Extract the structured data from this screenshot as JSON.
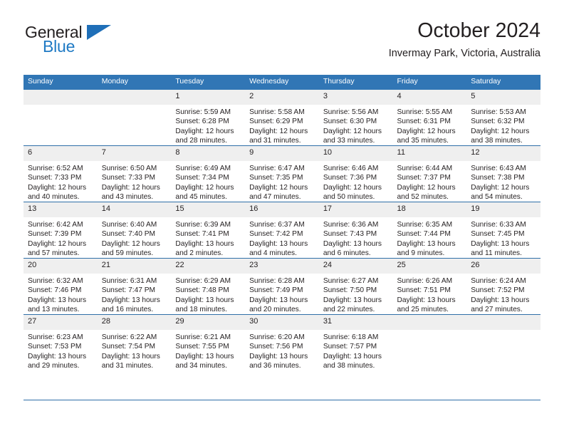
{
  "brand": {
    "name_top": "General",
    "name_bottom": "Blue",
    "icon": "triangle-logo-icon",
    "color_top": "#231f20",
    "color_bottom": "#1f7ac4",
    "triangle_color": "#1f6fb8"
  },
  "header": {
    "title": "October 2024",
    "subtitle": "Invermay Park, Victoria, Australia"
  },
  "theme": {
    "header_blue": "#3176b5",
    "rule_blue": "#2f6fa8",
    "daynum_band": "#efefef"
  },
  "weekdays": [
    "Sunday",
    "Monday",
    "Tuesday",
    "Wednesday",
    "Thursday",
    "Friday",
    "Saturday"
  ],
  "labels": {
    "sunrise": "Sunrise:",
    "sunset": "Sunset:",
    "daylight": "Daylight:"
  },
  "weeks": [
    [
      {
        "day": "",
        "lines": [
          "",
          "",
          "",
          ""
        ]
      },
      {
        "day": "",
        "lines": [
          "",
          "",
          "",
          ""
        ]
      },
      {
        "day": "1",
        "lines": [
          "Sunrise: 5:59 AM",
          "Sunset: 6:28 PM",
          "Daylight: 12 hours",
          "and 28 minutes."
        ]
      },
      {
        "day": "2",
        "lines": [
          "Sunrise: 5:58 AM",
          "Sunset: 6:29 PM",
          "Daylight: 12 hours",
          "and 31 minutes."
        ]
      },
      {
        "day": "3",
        "lines": [
          "Sunrise: 5:56 AM",
          "Sunset: 6:30 PM",
          "Daylight: 12 hours",
          "and 33 minutes."
        ]
      },
      {
        "day": "4",
        "lines": [
          "Sunrise: 5:55 AM",
          "Sunset: 6:31 PM",
          "Daylight: 12 hours",
          "and 35 minutes."
        ]
      },
      {
        "day": "5",
        "lines": [
          "Sunrise: 5:53 AM",
          "Sunset: 6:32 PM",
          "Daylight: 12 hours",
          "and 38 minutes."
        ]
      }
    ],
    [
      {
        "day": "6",
        "lines": [
          "Sunrise: 6:52 AM",
          "Sunset: 7:33 PM",
          "Daylight: 12 hours",
          "and 40 minutes."
        ]
      },
      {
        "day": "7",
        "lines": [
          "Sunrise: 6:50 AM",
          "Sunset: 7:33 PM",
          "Daylight: 12 hours",
          "and 43 minutes."
        ]
      },
      {
        "day": "8",
        "lines": [
          "Sunrise: 6:49 AM",
          "Sunset: 7:34 PM",
          "Daylight: 12 hours",
          "and 45 minutes."
        ]
      },
      {
        "day": "9",
        "lines": [
          "Sunrise: 6:47 AM",
          "Sunset: 7:35 PM",
          "Daylight: 12 hours",
          "and 47 minutes."
        ]
      },
      {
        "day": "10",
        "lines": [
          "Sunrise: 6:46 AM",
          "Sunset: 7:36 PM",
          "Daylight: 12 hours",
          "and 50 minutes."
        ]
      },
      {
        "day": "11",
        "lines": [
          "Sunrise: 6:44 AM",
          "Sunset: 7:37 PM",
          "Daylight: 12 hours",
          "and 52 minutes."
        ]
      },
      {
        "day": "12",
        "lines": [
          "Sunrise: 6:43 AM",
          "Sunset: 7:38 PM",
          "Daylight: 12 hours",
          "and 54 minutes."
        ]
      }
    ],
    [
      {
        "day": "13",
        "lines": [
          "Sunrise: 6:42 AM",
          "Sunset: 7:39 PM",
          "Daylight: 12 hours",
          "and 57 minutes."
        ]
      },
      {
        "day": "14",
        "lines": [
          "Sunrise: 6:40 AM",
          "Sunset: 7:40 PM",
          "Daylight: 12 hours",
          "and 59 minutes."
        ]
      },
      {
        "day": "15",
        "lines": [
          "Sunrise: 6:39 AM",
          "Sunset: 7:41 PM",
          "Daylight: 13 hours",
          "and 2 minutes."
        ]
      },
      {
        "day": "16",
        "lines": [
          "Sunrise: 6:37 AM",
          "Sunset: 7:42 PM",
          "Daylight: 13 hours",
          "and 4 minutes."
        ]
      },
      {
        "day": "17",
        "lines": [
          "Sunrise: 6:36 AM",
          "Sunset: 7:43 PM",
          "Daylight: 13 hours",
          "and 6 minutes."
        ]
      },
      {
        "day": "18",
        "lines": [
          "Sunrise: 6:35 AM",
          "Sunset: 7:44 PM",
          "Daylight: 13 hours",
          "and 9 minutes."
        ]
      },
      {
        "day": "19",
        "lines": [
          "Sunrise: 6:33 AM",
          "Sunset: 7:45 PM",
          "Daylight: 13 hours",
          "and 11 minutes."
        ]
      }
    ],
    [
      {
        "day": "20",
        "lines": [
          "Sunrise: 6:32 AM",
          "Sunset: 7:46 PM",
          "Daylight: 13 hours",
          "and 13 minutes."
        ]
      },
      {
        "day": "21",
        "lines": [
          "Sunrise: 6:31 AM",
          "Sunset: 7:47 PM",
          "Daylight: 13 hours",
          "and 16 minutes."
        ]
      },
      {
        "day": "22",
        "lines": [
          "Sunrise: 6:29 AM",
          "Sunset: 7:48 PM",
          "Daylight: 13 hours",
          "and 18 minutes."
        ]
      },
      {
        "day": "23",
        "lines": [
          "Sunrise: 6:28 AM",
          "Sunset: 7:49 PM",
          "Daylight: 13 hours",
          "and 20 minutes."
        ]
      },
      {
        "day": "24",
        "lines": [
          "Sunrise: 6:27 AM",
          "Sunset: 7:50 PM",
          "Daylight: 13 hours",
          "and 22 minutes."
        ]
      },
      {
        "day": "25",
        "lines": [
          "Sunrise: 6:26 AM",
          "Sunset: 7:51 PM",
          "Daylight: 13 hours",
          "and 25 minutes."
        ]
      },
      {
        "day": "26",
        "lines": [
          "Sunrise: 6:24 AM",
          "Sunset: 7:52 PM",
          "Daylight: 13 hours",
          "and 27 minutes."
        ]
      }
    ],
    [
      {
        "day": "27",
        "lines": [
          "Sunrise: 6:23 AM",
          "Sunset: 7:53 PM",
          "Daylight: 13 hours",
          "and 29 minutes."
        ]
      },
      {
        "day": "28",
        "lines": [
          "Sunrise: 6:22 AM",
          "Sunset: 7:54 PM",
          "Daylight: 13 hours",
          "and 31 minutes."
        ]
      },
      {
        "day": "29",
        "lines": [
          "Sunrise: 6:21 AM",
          "Sunset: 7:55 PM",
          "Daylight: 13 hours",
          "and 34 minutes."
        ]
      },
      {
        "day": "30",
        "lines": [
          "Sunrise: 6:20 AM",
          "Sunset: 7:56 PM",
          "Daylight: 13 hours",
          "and 36 minutes."
        ]
      },
      {
        "day": "31",
        "lines": [
          "Sunrise: 6:18 AM",
          "Sunset: 7:57 PM",
          "Daylight: 13 hours",
          "and 38 minutes."
        ]
      },
      {
        "day": "",
        "lines": [
          "",
          "",
          "",
          ""
        ]
      },
      {
        "day": "",
        "lines": [
          "",
          "",
          "",
          ""
        ]
      }
    ]
  ]
}
